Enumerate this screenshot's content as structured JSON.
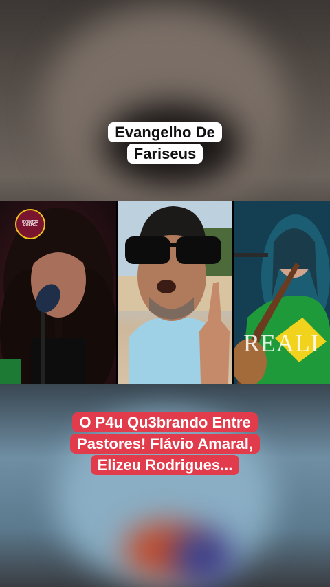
{
  "video": {
    "top_caption": "Evangelho De Fariseus",
    "bottom_caption": "O P4u Qu3brando Entre Pastores! Flávio Amaral, Elizeu Rodrigues...",
    "panel_right_overlay_text": "REALI",
    "logo_text": "EVENTOS GOSPEL"
  },
  "colors": {
    "top_caption_bg": "#ffffff",
    "bottom_caption_bg": "#e23c4c",
    "brazil_flag_green": "#1f9a3a",
    "brazil_flag_yellow": "#f1d21c"
  }
}
